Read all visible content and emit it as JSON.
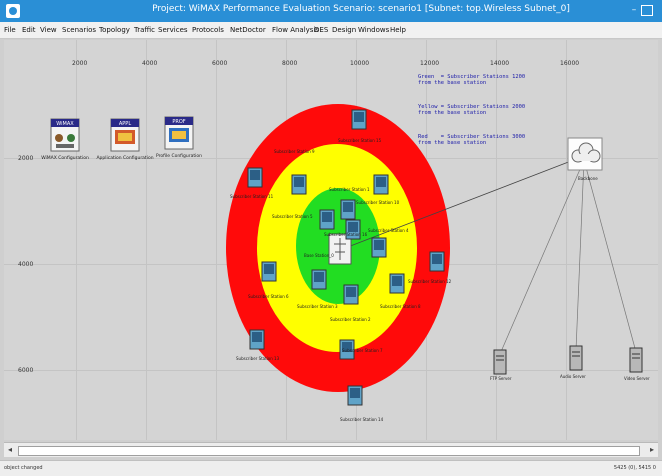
{
  "window": {
    "title": "Project: WiMAX Performance Evaluation Scenario: scenario1 [Subnet: top.Wireless Subnet_0]"
  },
  "menu": [
    "File",
    "Edit",
    "View",
    "Scenarios",
    "Topology",
    "Traffic",
    "Services",
    "Protocols",
    "NetDoctor",
    "Flow Analysis",
    "DES",
    "Design",
    "Windows",
    "Help"
  ],
  "ruler": {
    "top": [
      "2000",
      "4000",
      "6000",
      "8000",
      "10000",
      "12000",
      "14000",
      "16000"
    ],
    "left": [
      "2000",
      "4000",
      "6000"
    ]
  },
  "legend": [
    [
      "Green  = Subscriber Stations 1200",
      "from the base station"
    ],
    [
      "Yellow = Subscriber Stations 2000",
      "from the base station"
    ],
    [
      "Red    = Subscriber Stations 3000",
      "from the base station"
    ]
  ],
  "config_objects": [
    {
      "label": "WiMAX Configuration",
      "header": "WiMAX",
      "icon": "wimax-config-icon"
    },
    {
      "label": "Application Configuration",
      "header": "APPL",
      "icon": "application-config-icon"
    },
    {
      "label": "Profile Configuration",
      "header": "PROF",
      "icon": "profile-config-icon"
    }
  ],
  "nodes": {
    "base_station": "Base Station_0",
    "subscribers": [
      "Subscriber Station 1",
      "Subscriber Station 2",
      "Subscriber Station 3",
      "Subscriber Station 4",
      "Subscriber Station 5",
      "Subscriber Station 6",
      "Subscriber Station 7",
      "Subscriber Station 8",
      "Subscriber Station 9",
      "Subscriber Station 10",
      "Subscriber Station 11",
      "Subscriber Station 12",
      "Subscriber Station 13",
      "Subscriber Station 14",
      "Subscriber Station 15",
      "Subscriber Station 16"
    ],
    "cloud": "Backbone",
    "servers": [
      "FTP Server",
      "Audio Server",
      "Video Server"
    ]
  },
  "colors": {
    "zone_green": "#22dd22",
    "zone_yellow": "#ffff00",
    "zone_red": "#ff0a0a",
    "titlebar": "#2a8fd6",
    "legend_text": "#1a1aa8"
  },
  "status": {
    "left": "object changed",
    "right": "5425 (0), 5415 0"
  }
}
